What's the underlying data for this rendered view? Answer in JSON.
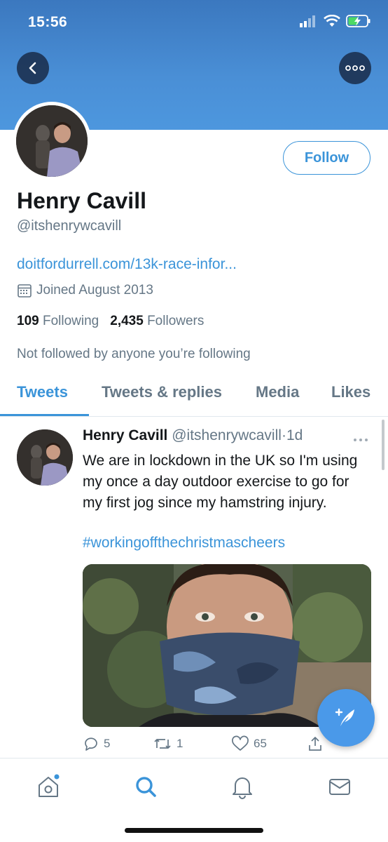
{
  "status_bar": {
    "time": "15:56"
  },
  "profile": {
    "follow_label": "Follow",
    "name": "Henry Cavill",
    "handle": "@itshenrywcavill",
    "website": "doitfordurrell.com/13k-race-infor...",
    "joined": "Joined August 2013",
    "following_count": "109",
    "following_label": "Following",
    "followers_count": "2,435",
    "followers_label": "Followers",
    "not_followed_text": "Not followed by anyone you’re following"
  },
  "tabs": [
    {
      "label": "Tweets",
      "active": true
    },
    {
      "label": "Tweets & replies",
      "active": false
    },
    {
      "label": "Media",
      "active": false
    },
    {
      "label": "Likes",
      "active": false
    }
  ],
  "tweet": {
    "author_name": "Henry Cavill",
    "author_handle": "@itshenrywcavill",
    "separator": "·",
    "age": "1d",
    "text": "We are in lockdown in the UK so I'm using my once a day outdoor exercise to go for my first jog since my hamstring injury.",
    "hashtag": "#workingoffthechristmascheers",
    "replies": "5",
    "retweets": "1",
    "likes": "65"
  },
  "icons": {
    "back": "chevron-left-icon",
    "more": "ellipsis-icon",
    "compose": "feather-plus-icon",
    "nav": [
      "home-icon",
      "search-icon",
      "notifications-bell-icon",
      "messages-envelope-icon"
    ]
  },
  "colors": {
    "accent": "#3b94d9",
    "banner": "#4a8fd6",
    "secondary_text": "#657786",
    "fab": "#4a99e9"
  }
}
